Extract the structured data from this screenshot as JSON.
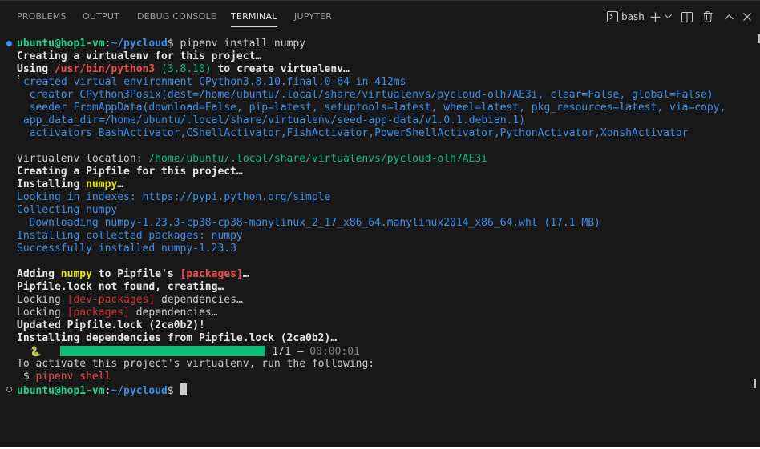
{
  "tabs": [
    {
      "label": "PROBLEMS"
    },
    {
      "label": "OUTPUT"
    },
    {
      "label": "DEBUG CONSOLE"
    },
    {
      "label": "TERMINAL",
      "active": true
    },
    {
      "label": "JUPYTER"
    }
  ],
  "toolbar": {
    "shell_label": "bash",
    "icons": [
      "terminal-icon",
      "add-icon",
      "chevron-down-icon",
      "split-icon",
      "trash-icon",
      "chevron-up-icon",
      "close-icon"
    ]
  },
  "prompt": {
    "user_host": "ubuntu@hop1-vm",
    "path": "~/pycloud",
    "sep": ":",
    "dollar": "$ "
  },
  "lines": {
    "cmd": "pipenv install numpy",
    "l1": "Creating a virtualenv for this project…",
    "l2a": "Using ",
    "l2b": "/usr/bin/python3",
    "l2c": " (3.8.10)",
    "l2d": " to create virtualenv…",
    "l3": "created virtual environment CPython3.8.10.final.0-64 in 412ms",
    "l4": "  creator CPython3Posix(dest=/home/ubuntu/.local/share/virtualenvs/pycloud-olh7AE3i, clear=False, global=False)",
    "l5": "  seeder FromAppData(download=False, pip=latest, setuptools=latest, wheel=latest, pkg_resources=latest, via=copy,",
    "l6": "app_data_dir=/home/ubuntu/.local/share/virtualenv/seed-app-data/v1.0.1.debian.1)",
    "l7": "  activators BashActivator,CShellActivator,FishActivator,PowerShellActivator,PythonActivator,XonshActivator",
    "l8a": "Virtualenv location: ",
    "l8b": "/home/ubuntu/.local/share/virtualenvs/pycloud-olh7AE3i",
    "l9": "Creating a Pipfile for this project…",
    "l10a": "Installing ",
    "l10b": "numpy",
    "l10c": "…",
    "l11": "Looking in indexes: https://pypi.python.org/simple",
    "l12": "Collecting numpy",
    "l13": "  Downloading numpy-1.23.3-cp38-cp38-manylinux_2_17_x86_64.manylinux2014_x86_64.whl (17.1 MB)",
    "l14": "Installing collected packages: numpy",
    "l15": "Successfully installed numpy-1.23.3",
    "l16a": "Adding ",
    "l16b": "numpy",
    "l16c": " to Pipfile's ",
    "l16d": "[packages]",
    "l16e": "…",
    "l17": "Pipfile.lock not found, creating…",
    "l18a": "Locking ",
    "l18b": "[dev-packages]",
    "l18c": " dependencies…",
    "l19a": "Locking ",
    "l19b": "[packages]",
    "l19c": " dependencies…",
    "l20": "Updated Pipfile.lock (2ca0b2)!",
    "l21": "Installing dependencies from Pipfile.lock (2ca0b2)…",
    "l22_icon": "🐍",
    "l22_progress": "1/1 — ",
    "l22_time": "00:00:01",
    "l23": "To activate this project's virtualenv, run the following:",
    "l24a": " $ ",
    "l24b": "pipenv shell"
  },
  "progress": {
    "value": 1,
    "total": 1
  },
  "colors": {
    "background": "#181818",
    "green": "#23d18b",
    "blue": "#3b8eea",
    "red": "#f14c4c",
    "yellow": "#e5e510"
  }
}
